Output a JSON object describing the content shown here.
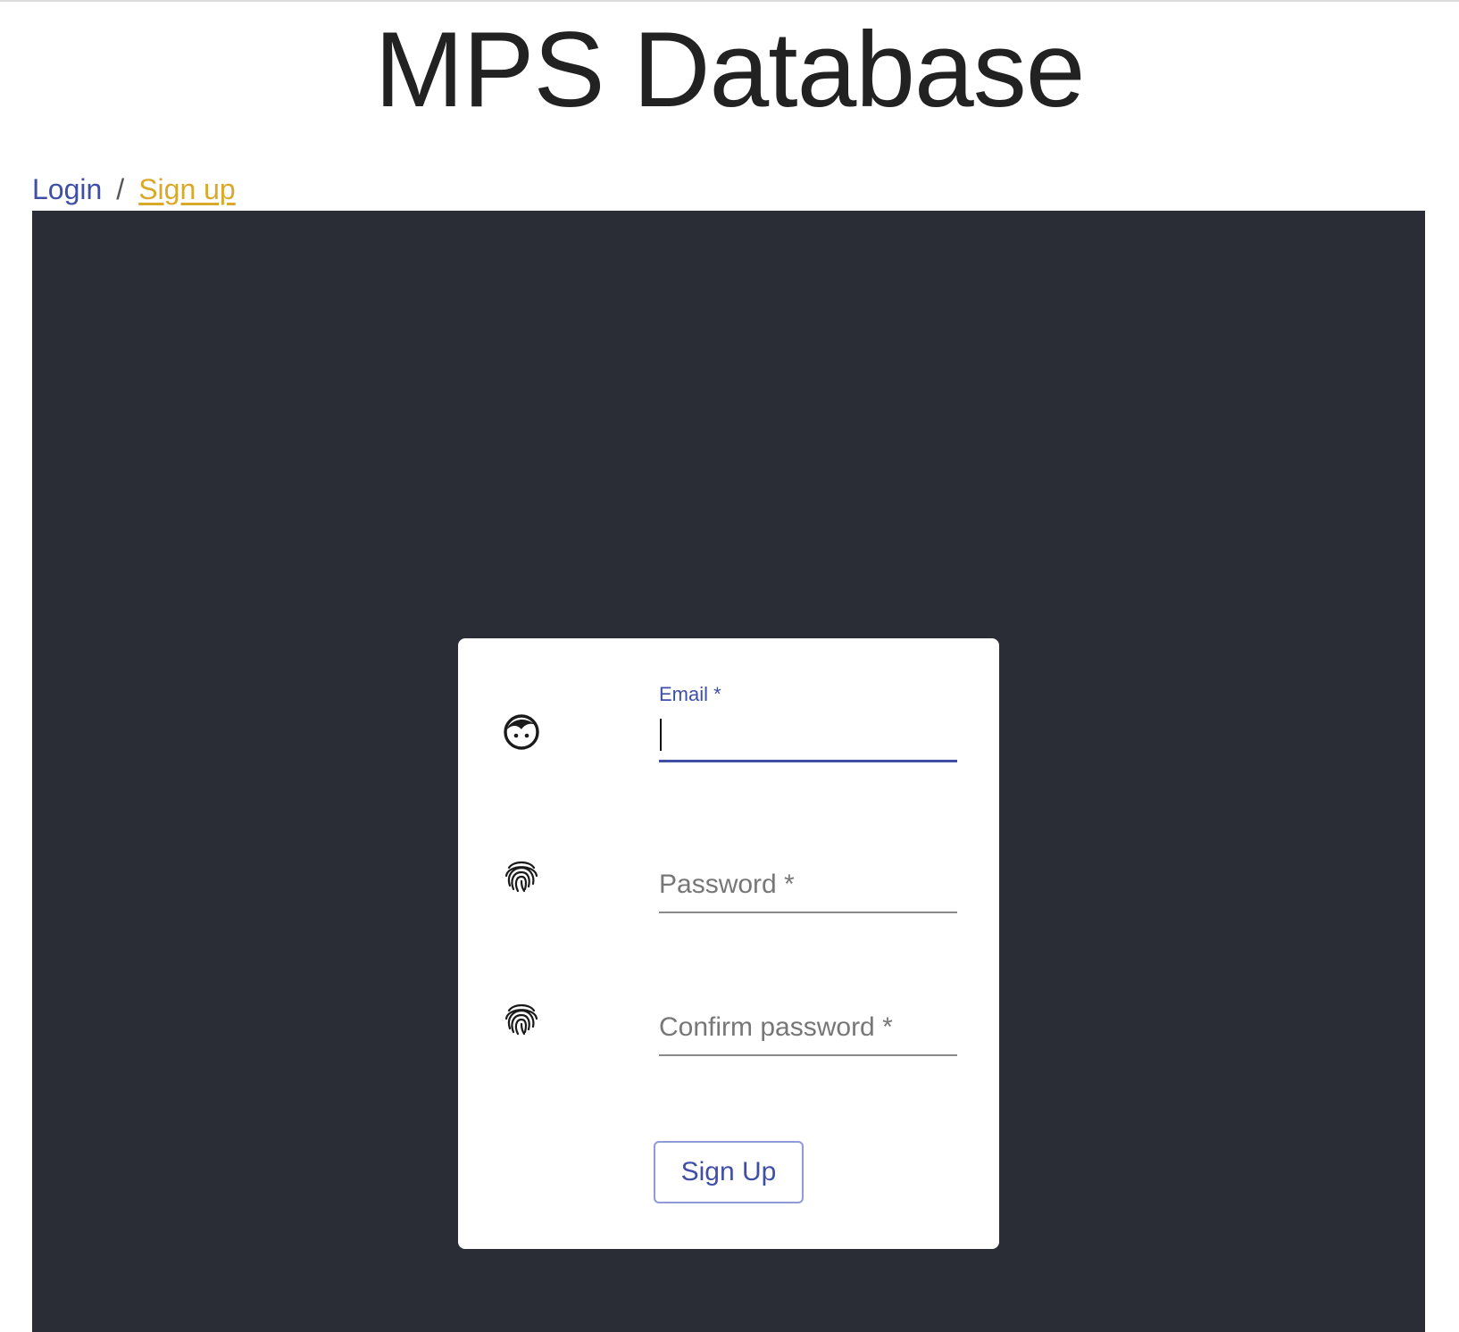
{
  "app": {
    "title": "MPS Database"
  },
  "breadcrumb": {
    "login": "Login",
    "separator": "/",
    "signup": "Sign up"
  },
  "form": {
    "email": {
      "label": "Email *",
      "value": ""
    },
    "password": {
      "placeholder": "Password *",
      "value": ""
    },
    "confirm_password": {
      "placeholder": "Confirm password *",
      "value": ""
    },
    "submit_label": "Sign Up"
  },
  "icons": {
    "email": "face-icon",
    "password": "fingerprint-icon",
    "confirm_password": "fingerprint-icon"
  },
  "colors": {
    "accent": "#3f4fa6",
    "link_active": "#d9a92b",
    "panel_background": "#2a2d35",
    "card_background": "#ffffff"
  }
}
